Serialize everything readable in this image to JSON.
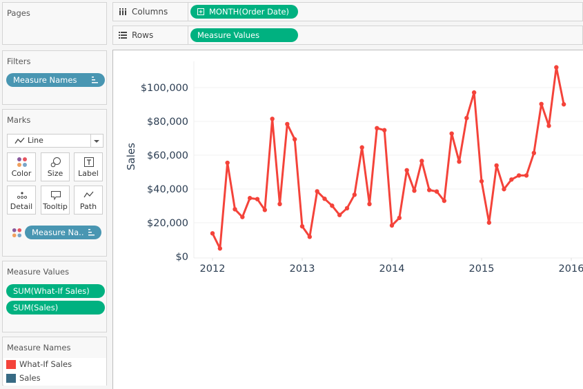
{
  "pages": {
    "title": "Pages"
  },
  "filters": {
    "title": "Filters",
    "pills": [
      {
        "label": "Measure Names",
        "icon": "sort-icon"
      }
    ]
  },
  "marks": {
    "title": "Marks",
    "mark_type": "Line",
    "mark_type_icon": "line-icon",
    "buttons": [
      {
        "label": "Color",
        "icon": "color-dots-icon"
      },
      {
        "label": "Size",
        "icon": "size-icon"
      },
      {
        "label": "Label",
        "icon": "text-label-icon"
      },
      {
        "label": "Detail",
        "icon": "detail-icon"
      },
      {
        "label": "Tooltip",
        "icon": "tooltip-icon"
      },
      {
        "label": "Path",
        "icon": "path-icon"
      }
    ],
    "color_pill": {
      "label": "Measure Na..",
      "icon": "sort-icon"
    }
  },
  "measure_values": {
    "title": "Measure Values",
    "pills": [
      {
        "label": "SUM(What-If Sales)"
      },
      {
        "label": "SUM(Sales)"
      }
    ]
  },
  "measure_names_legend": {
    "title": "Measure Names",
    "items": [
      {
        "label": "What-If Sales",
        "color": "#f4433a"
      },
      {
        "label": "Sales",
        "color": "#376a84"
      }
    ]
  },
  "shelves": {
    "columns": {
      "label": "Columns",
      "icon": "columns-icon",
      "pill": "MONTH(Order Date)",
      "pill_icon": "expand-plus-icon"
    },
    "rows": {
      "label": "Rows",
      "icon": "rows-icon",
      "pill": "Measure Values"
    }
  },
  "colors": {
    "pill_blue": "#4996b2",
    "pill_green": "#00b180",
    "line": "#f4433a",
    "axis_text": "#2b3d52"
  },
  "chart_data": {
    "type": "line",
    "title": "",
    "xlabel": "",
    "ylabel": "Sales",
    "x_tick_labels": [
      "2012",
      "2013",
      "2014",
      "2015",
      "2016"
    ],
    "y_tick_labels": [
      "$0",
      "$20,000",
      "$40,000",
      "$60,000",
      "$80,000",
      "$100,000"
    ],
    "y_ticks": [
      0,
      20000,
      40000,
      60000,
      80000,
      100000
    ],
    "ylim": [
      -4000,
      115000
    ],
    "x_start": "2012-01",
    "grid": true,
    "legend": "sidebar",
    "series": [
      {
        "name": "What-If Sales",
        "color": "#f4433a",
        "x": [
          "2012-01",
          "2012-02",
          "2012-03",
          "2012-04",
          "2012-05",
          "2012-06",
          "2012-07",
          "2012-08",
          "2012-09",
          "2012-10",
          "2012-11",
          "2012-12",
          "2013-01",
          "2013-02",
          "2013-03",
          "2013-04",
          "2013-05",
          "2013-06",
          "2013-07",
          "2013-08",
          "2013-09",
          "2013-10",
          "2013-11",
          "2013-12",
          "2014-01",
          "2014-02",
          "2014-03",
          "2014-04",
          "2014-05",
          "2014-06",
          "2014-07",
          "2014-08",
          "2014-09",
          "2014-10",
          "2014-11",
          "2014-12",
          "2015-01",
          "2015-02",
          "2015-03",
          "2015-04",
          "2015-05",
          "2015-06",
          "2015-07",
          "2015-08",
          "2015-09",
          "2015-10",
          "2015-11",
          "2015-12"
        ],
        "values": [
          13750,
          4800,
          55500,
          28000,
          23400,
          34600,
          34000,
          27600,
          81500,
          31100,
          78400,
          69400,
          17900,
          11700,
          38600,
          34200,
          30100,
          24600,
          28600,
          36600,
          64600,
          31100,
          76000,
          74800,
          18400,
          22900,
          51100,
          39000,
          56600,
          39400,
          38500,
          33000,
          72800,
          56200,
          82000,
          97100,
          44600,
          20100,
          53900,
          39900,
          45600,
          48000,
          48000,
          61300,
          90300,
          77400,
          112000,
          90100
        ]
      }
    ]
  }
}
